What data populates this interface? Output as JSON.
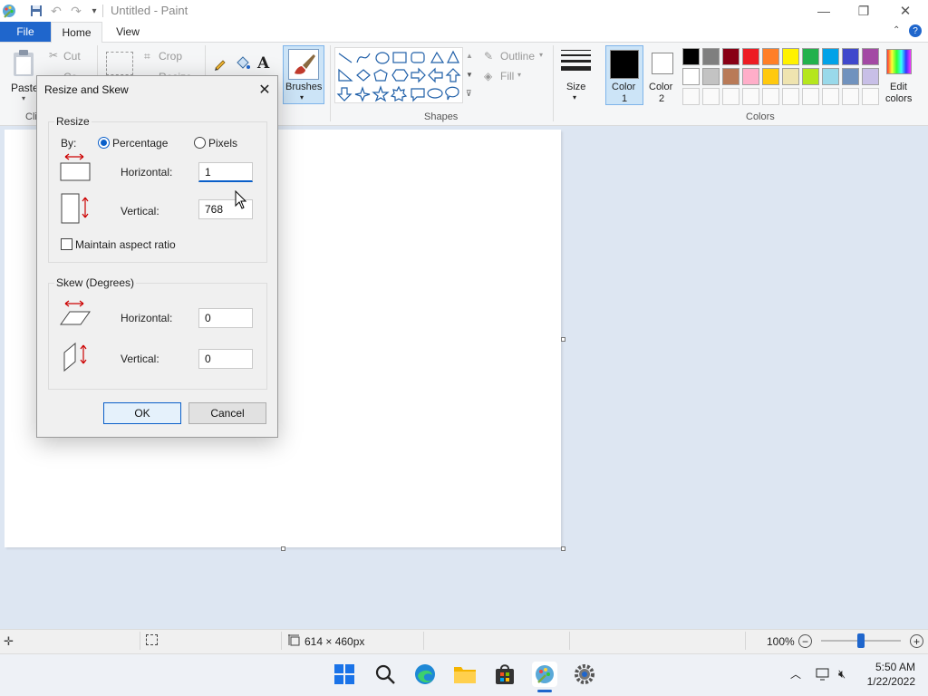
{
  "window": {
    "title": "Untitled - Paint",
    "minimize": "—",
    "maximize": "❐",
    "close": "✕"
  },
  "quick_access": {
    "save": "save-icon",
    "undo": "undo-icon",
    "redo": "redo-icon",
    "customize": "dropdown-icon"
  },
  "tabs": {
    "file": "File",
    "home": "Home",
    "view": "View"
  },
  "ribbon": {
    "clipboard": {
      "paste": "Paste",
      "cut": "Cut",
      "copy": "Co",
      "group": "Cli"
    },
    "image": {
      "crop": "Crop",
      "resize": "Resize"
    },
    "brushes": "Brushes",
    "shapes": {
      "outline": "Outline",
      "fill": "Fill",
      "group": "Shapes"
    },
    "size": "Size",
    "color1": {
      "line1": "Color",
      "line2": "1"
    },
    "color2": {
      "line1": "Color",
      "line2": "2"
    },
    "edit_colors": {
      "line1": "Edit",
      "line2": "colors"
    },
    "colors_group": "Colors",
    "palette_row1": [
      "#000000",
      "#7f7f7f",
      "#880015",
      "#ed1c24",
      "#ff7f27",
      "#fff200",
      "#22b14c",
      "#00a2e8",
      "#3f48cc",
      "#a349a4"
    ],
    "palette_row2": [
      "#ffffff",
      "#c3c3c3",
      "#b97a57",
      "#ffaec9",
      "#ffc90e",
      "#efe4b0",
      "#b5e61d",
      "#99d9ea",
      "#7092be",
      "#c8bfe7"
    ]
  },
  "dialog": {
    "title": "Resize and Skew",
    "resize_group": "Resize",
    "by_label": "By:",
    "percentage": "Percentage",
    "pixels": "Pixels",
    "horizontal_label": "Horizontal:",
    "horizontal_value": "1",
    "vertical_label": "Vertical:",
    "vertical_value": "768",
    "maintain": "Maintain aspect ratio",
    "skew_group": "Skew (Degrees)",
    "skew_h_label": "Horizontal:",
    "skew_h_value": "0",
    "skew_v_label": "Vertical:",
    "skew_v_value": "0",
    "ok": "OK",
    "cancel": "Cancel"
  },
  "status": {
    "canvas_size": "614 × 460px",
    "zoom": "100%",
    "zoom_minus": "−",
    "zoom_plus": "+"
  },
  "taskbar": {
    "time": "5:50 AM",
    "date": "1/22/2022"
  }
}
